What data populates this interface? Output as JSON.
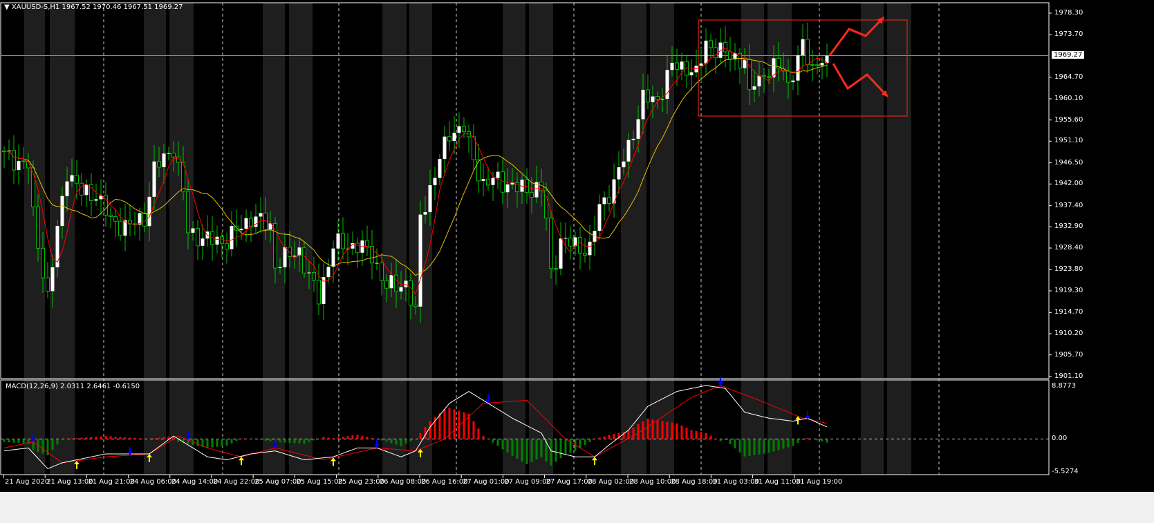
{
  "header": {
    "symbol": "XAUUSD-S,H1",
    "open": "1967.52",
    "high": "1970.46",
    "low": "1967.51",
    "close": "1969.27"
  },
  "macd_header": {
    "label": "MACD(12,26,9)",
    "macd": "2.0311",
    "signal": "2.6461",
    "hist": "-0.6150"
  },
  "current_price": "1969.27",
  "colors": {
    "bull": "#ffffff",
    "wick": "#00c000",
    "ma_fast": "#ff0000",
    "ma_slow": "#e6c200",
    "hist_up": "#ff0000",
    "hist_down": "#008000",
    "macd_line": "#ffffff",
    "signal_line": "#ff0000",
    "arrow_buy": "#ffff00",
    "arrow_sell": "#0000ff",
    "annotation": "#ff2a1a"
  },
  "chart_data": [
    {
      "type": "candlestick",
      "title": "XAUUSD-S,H1",
      "bars": 171,
      "ylim": [
        1901.1,
        1978.3
      ],
      "y_ticks": [
        "1978.30",
        "1973.70",
        "1964.70",
        "1960.10",
        "1955.60",
        "1951.10",
        "1946.50",
        "1942.00",
        "1937.40",
        "1932.90",
        "1928.40",
        "1923.80",
        "1919.30",
        "1914.70",
        "1910.20",
        "1905.70",
        "1901.10"
      ],
      "y_tick_values": [
        1978.3,
        1973.7,
        1964.7,
        1960.1,
        1955.6,
        1951.1,
        1946.5,
        1942.0,
        1937.4,
        1932.9,
        1928.4,
        1923.8,
        1919.3,
        1914.7,
        1910.2,
        1905.7,
        1901.1
      ],
      "x_ticks": [
        "21 Aug 2020",
        "21 Aug 13:00",
        "21 Aug 21:00",
        "24 Aug 06:00",
        "24 Aug 14:00",
        "24 Aug 22:00",
        "25 Aug 07:00",
        "25 Aug 15:00",
        "25 Aug 23:00",
        "26 Aug 08:00",
        "26 Aug 16:00",
        "27 Aug 01:00",
        "27 Aug 09:00",
        "27 Aug 17:00",
        "28 Aug 02:00",
        "28 Aug 10:00",
        "28 Aug 18:00",
        "31 Aug 03:00",
        "31 Aug 11:00",
        "31 Aug 19:00"
      ],
      "close_path": [
        [
          0,
          1948
        ],
        [
          5,
          1946
        ],
        [
          6,
          1935
        ],
        [
          9,
          1918
        ],
        [
          11,
          1932
        ],
        [
          13,
          1945
        ],
        [
          16,
          1940
        ],
        [
          19,
          1940
        ],
        [
          22,
          1934
        ],
        [
          26,
          1933
        ],
        [
          29,
          1935
        ],
        [
          31,
          1945
        ],
        [
          35,
          1950
        ],
        [
          37,
          1940
        ],
        [
          38,
          1932
        ],
        [
          42,
          1930
        ],
        [
          46,
          1930
        ],
        [
          51,
          1935
        ],
        [
          55,
          1933
        ],
        [
          56,
          1925
        ],
        [
          61,
          1928
        ],
        [
          63,
          1922
        ],
        [
          65,
          1918
        ],
        [
          68,
          1929
        ],
        [
          73,
          1929
        ],
        [
          76,
          1927
        ],
        [
          79,
          1920
        ],
        [
          83,
          1921
        ],
        [
          85,
          1914
        ],
        [
          86,
          1935
        ],
        [
          89,
          1944
        ],
        [
          92,
          1953
        ],
        [
          95,
          1954
        ],
        [
          96,
          1950
        ],
        [
          99,
          1942
        ],
        [
          102,
          1943
        ],
        [
          106,
          1941
        ],
        [
          111,
          1941
        ],
        [
          112,
          1934
        ],
        [
          113,
          1923
        ],
        [
          115,
          1930
        ],
        [
          118,
          1929
        ],
        [
          121,
          1928
        ],
        [
          123,
          1937
        ],
        [
          126,
          1942
        ],
        [
          129,
          1950
        ],
        [
          132,
          1960
        ],
        [
          135,
          1960
        ],
        [
          138,
          1967
        ],
        [
          141,
          1967
        ],
        [
          143,
          1965
        ],
        [
          145,
          1972
        ],
        [
          148,
          1970
        ],
        [
          151,
          1969
        ],
        [
          153,
          1968
        ],
        [
          154,
          1960
        ],
        [
          155,
          1964
        ],
        [
          158,
          1966
        ],
        [
          161,
          1967
        ],
        [
          162,
          1963
        ],
        [
          165,
          1971
        ],
        [
          167,
          1967
        ],
        [
          170,
          1969.27
        ]
      ],
      "moving_averages": [
        {
          "name": "MA fast",
          "period": 5
        },
        {
          "name": "MA slow",
          "period": 13
        }
      ],
      "current_price": 1969.27
    },
    {
      "type": "line",
      "title": "MACD(12,26,9)",
      "ylim": [
        -5.5274,
        8.8773
      ],
      "y_ticks": [
        "8.8773",
        "0.00",
        "-5.5274"
      ],
      "series": [
        {
          "name": "MACD",
          "points": [
            [
              0,
              -2
            ],
            [
              5,
              -1.5
            ],
            [
              9,
              -5
            ],
            [
              12,
              -4
            ],
            [
              15,
              -3.5
            ],
            [
              21,
              -2.5
            ],
            [
              26,
              -2.5
            ],
            [
              30,
              -2.5
            ],
            [
              35,
              0.5
            ],
            [
              38,
              -1
            ],
            [
              42,
              -3
            ],
            [
              46,
              -3.5
            ],
            [
              51,
              -2.5
            ],
            [
              56,
              -2
            ],
            [
              62,
              -3.5
            ],
            [
              68,
              -3
            ],
            [
              73,
              -1.5
            ],
            [
              77,
              -1.5
            ],
            [
              82,
              -3
            ],
            [
              85,
              -2
            ],
            [
              88,
              2
            ],
            [
              92,
              6
            ],
            [
              96,
              8
            ],
            [
              99,
              6.5
            ],
            [
              105,
              3.5
            ],
            [
              111,
              1
            ],
            [
              113,
              -2
            ],
            [
              118,
              -3
            ],
            [
              122,
              -3
            ],
            [
              125,
              -1
            ],
            [
              129,
              1.5
            ],
            [
              133,
              5.5
            ],
            [
              139,
              8
            ],
            [
              145,
              9
            ],
            [
              149,
              8.5
            ],
            [
              153,
              4.5
            ],
            [
              158,
              3.5
            ],
            [
              163,
              3
            ],
            [
              166,
              3.5
            ],
            [
              170,
              2.03
            ]
          ]
        },
        {
          "name": "Signal",
          "points": [
            [
              0,
              -1.5
            ],
            [
              6,
              -0.5
            ],
            [
              12,
              -4
            ],
            [
              21,
              -3
            ],
            [
              30,
              -2.5
            ],
            [
              36,
              0.5
            ],
            [
              42,
              -1.5
            ],
            [
              49,
              -3
            ],
            [
              56,
              -1.5
            ],
            [
              66,
              -3.5
            ],
            [
              77,
              -1.5
            ],
            [
              85,
              -2
            ],
            [
              91,
              0
            ],
            [
              99,
              6
            ],
            [
              108,
              6.5
            ],
            [
              116,
              0
            ],
            [
              122,
              -3
            ],
            [
              131,
              1
            ],
            [
              142,
              7
            ],
            [
              148,
              9
            ],
            [
              156,
              6.5
            ],
            [
              165,
              3.5
            ],
            [
              170,
              2.65
            ]
          ]
        }
      ],
      "histogram": "MACD minus Signal",
      "sell_arrows": [
        6,
        26,
        38,
        56,
        77,
        100,
        148,
        166
      ],
      "buy_arrows": [
        15,
        30,
        49,
        68,
        86,
        122,
        164
      ]
    }
  ]
}
